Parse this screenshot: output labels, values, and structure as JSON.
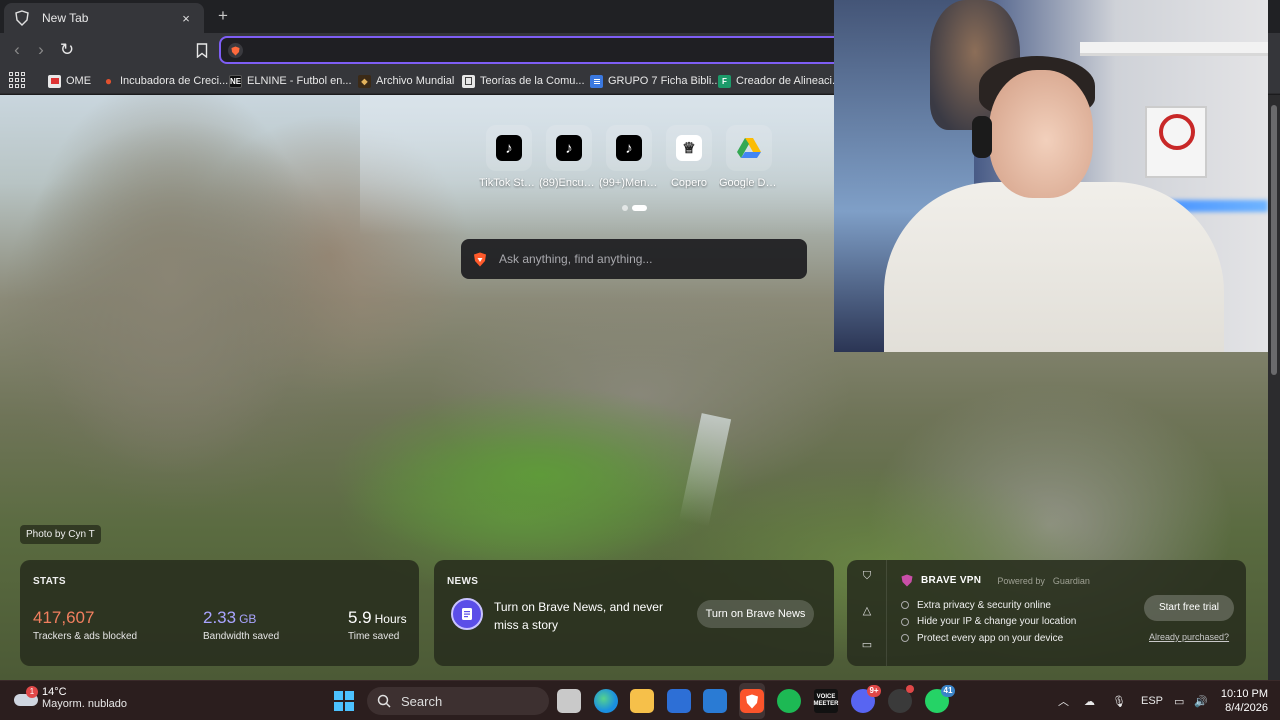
{
  "browser": {
    "tab_title": "New Tab",
    "tab_close": "×",
    "new_tab": "+",
    "nav": {
      "back": "‹",
      "forward": "›",
      "reload": "↻",
      "bookmark": "☐"
    }
  },
  "bookmarks": [
    {
      "label": "OME",
      "icon": "",
      "color": "#d9d9d9"
    },
    {
      "label": "Incubadora de Creci...",
      "icon": "",
      "color": "#d9452e"
    },
    {
      "label": "ELNINE - Futbol en...",
      "icon": "NE",
      "color": "#111111"
    },
    {
      "label": "Archivo Mundial",
      "icon": "",
      "color": "#b47a2a"
    },
    {
      "label": "Teorías de la Comu...",
      "icon": "",
      "color": "#e0e0e0"
    },
    {
      "label": "GRUPO 7 Ficha Bibli...",
      "icon": "",
      "color": "#3a78e0"
    },
    {
      "label": "Creador de Alineaci...",
      "icon": "F",
      "color": "#1c9b6a"
    }
  ],
  "newtab": {
    "photo_credit": "Photo by Cyn T",
    "search_placeholder": "Ask anything, find anything...",
    "top_sites": [
      {
        "label": "TikTok Stu...",
        "icon": "♪",
        "bg": "#000000",
        "fg": "#ffffff"
      },
      {
        "label": "(89)Encuen...",
        "icon": "♪",
        "bg": "#000000",
        "fg": "#ffffff"
      },
      {
        "label": "(99+)Mens...",
        "icon": "♪",
        "bg": "#000000",
        "fg": "#ffffff"
      },
      {
        "label": "Copero",
        "icon": "♕",
        "bg": "#ffffff",
        "fg": "#222222"
      },
      {
        "label": "Google Drive",
        "icon": "▲",
        "bg": "transparent",
        "fg": "#34a853"
      }
    ],
    "stats": {
      "heading": "STATS",
      "trackers_value": "417,607",
      "trackers_label": "Trackers & ads blocked",
      "bandwidth_value": "2.33",
      "bandwidth_unit": "GB",
      "bandwidth_label": "Bandwidth saved",
      "time_value": "5.9",
      "time_unit": "Hours",
      "time_label": "Time saved",
      "colors": {
        "trackers": "#f17f5f",
        "bandwidth": "#a9a4ff",
        "time": "#ffffff"
      }
    },
    "news": {
      "heading": "NEWS",
      "text": "Turn on Brave News, and never miss a story",
      "button": "Turn on Brave News"
    },
    "vpn": {
      "title": "BRAVE VPN",
      "powered_by": "Powered by",
      "partner": "Guardian",
      "features": [
        "Extra privacy & security online",
        "Hide your IP & change your location",
        "Protect every app on your device"
      ],
      "cta": "Start free trial",
      "already": "Already purchased?"
    }
  },
  "taskbar": {
    "weather_temp": "14°C",
    "weather_desc": "Mayorm. nublado",
    "weather_badge": "1",
    "search_label": "Search",
    "language": "ESP",
    "time": "10:10 PM",
    "date": "8/4/2026",
    "discord_badge": "9+",
    "whatsapp_badge": "41",
    "voicemeeter_label": "VOICE MEETER"
  }
}
